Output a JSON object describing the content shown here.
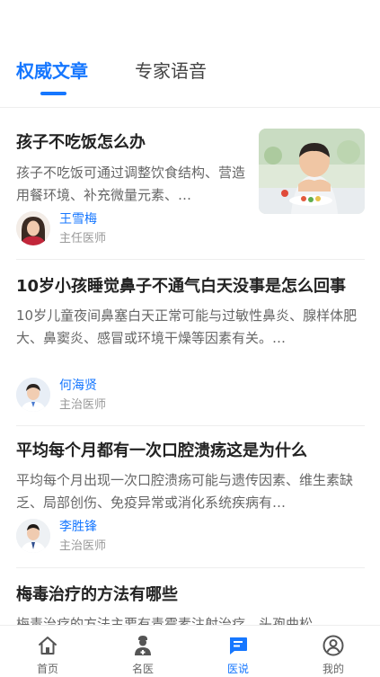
{
  "tabs": {
    "items": [
      {
        "label": "权威文章",
        "active": true
      },
      {
        "label": "专家语音",
        "active": false
      }
    ],
    "active_color": "#1677ff"
  },
  "articles": [
    {
      "title": "孩子不吃饭怎么办",
      "summary": "孩子不吃饭可通过调整饮食结构、营造用餐环境、补充微量元素、…",
      "author": {
        "name": "王雪梅",
        "title": "主任医师"
      },
      "has_image": true
    },
    {
      "title": "10岁小孩睡觉鼻子不通气白天没事是怎么回事",
      "summary": "10岁儿童夜间鼻塞白天正常可能与过敏性鼻炎、腺样体肥大、鼻窦炎、感冒或环境干燥等因素有关。…",
      "author": {
        "name": "何海贤",
        "title": "主治医师"
      }
    },
    {
      "title": "平均每个月都有一次口腔溃疡这是为什么",
      "summary": "平均每个月出现一次口腔溃疡可能与遗传因素、维生素缺乏、局部创伤、免疫异常或消化系统疾病有…",
      "author": {
        "name": "李胜锋",
        "title": "主治医师"
      }
    },
    {
      "title": "梅毒治疗的方法有哪些",
      "summary": "梅毒治疗的方法主要有青霉素注射治疗、头孢曲松…"
    }
  ],
  "tabbar": {
    "items": [
      {
        "label": "首页",
        "icon": "home-icon",
        "active": false
      },
      {
        "label": "名医",
        "icon": "doctor-icon",
        "active": false
      },
      {
        "label": "医说",
        "icon": "chat-icon",
        "active": true
      },
      {
        "label": "我的",
        "icon": "profile-icon",
        "active": false
      }
    ],
    "active_color": "#1677ff",
    "inactive_color": "#555555"
  }
}
